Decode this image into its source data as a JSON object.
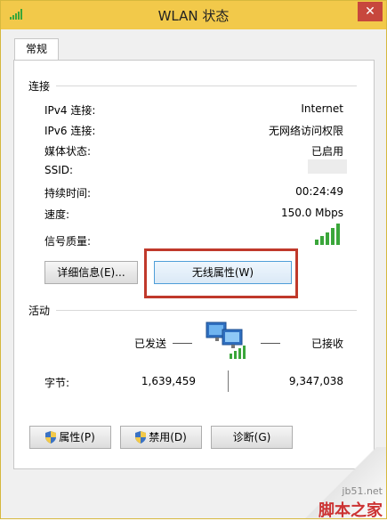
{
  "window": {
    "title": "WLAN 状态",
    "close_glyph": "✕"
  },
  "tabs": [
    {
      "label": "常规"
    }
  ],
  "connection": {
    "section_title": "连接",
    "rows": [
      {
        "label": "IPv4 连接:",
        "value": "Internet"
      },
      {
        "label": "IPv6 连接:",
        "value": "无网络访问权限"
      },
      {
        "label": "媒体状态:",
        "value": "已启用"
      },
      {
        "label": "SSID:",
        "value": ""
      },
      {
        "label": "持续时间:",
        "value": "00:24:49"
      },
      {
        "label": "速度:",
        "value": "150.0 Mbps"
      },
      {
        "label": "信号质量:",
        "value": ""
      }
    ],
    "signal_bars": 5
  },
  "buttons": {
    "details": "详细信息(E)...",
    "wireless_properties": "无线属性(W)"
  },
  "activity": {
    "section_title": "活动",
    "sent_label": "已发送",
    "received_label": "已接收",
    "bytes_label": "字节:",
    "bytes_sent": "1,639,459",
    "bytes_received": "9,347,038"
  },
  "bottom_buttons": {
    "properties": "属性(P)",
    "disable": "禁用(D)",
    "diagnose": "诊断(G)"
  },
  "watermark": {
    "line1": "jb51.net",
    "line2": "脚本之家"
  },
  "colors": {
    "titlebar": "#f2c94a",
    "close": "#c7473d",
    "highlight": "#c0392b",
    "signal": "#3aa63a"
  }
}
